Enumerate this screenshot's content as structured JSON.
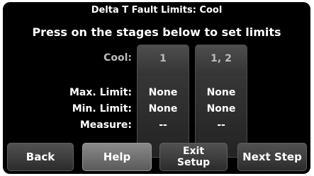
{
  "header": {
    "title": "Delta T Fault Limits: Cool",
    "instruction": "Press on the stages below to set limits"
  },
  "stages": {
    "row_label": "Cool:",
    "columns": [
      "1",
      "1, 2"
    ]
  },
  "rows": [
    {
      "label": "Max. Limit:",
      "values": [
        "None",
        "None"
      ]
    },
    {
      "label": "Min. Limit:",
      "values": [
        "None",
        "None"
      ]
    },
    {
      "label": "Measure:",
      "values": [
        "--",
        "--"
      ]
    }
  ],
  "footer": {
    "back": "Back",
    "help": "Help",
    "exit_line1": "Exit",
    "exit_line2": "Setup",
    "next": "Next Step"
  },
  "colors": {
    "background": "#000000",
    "text": "#ffffff",
    "dim_text": "#bdbdbd",
    "help_button": "#7a7a7a"
  }
}
